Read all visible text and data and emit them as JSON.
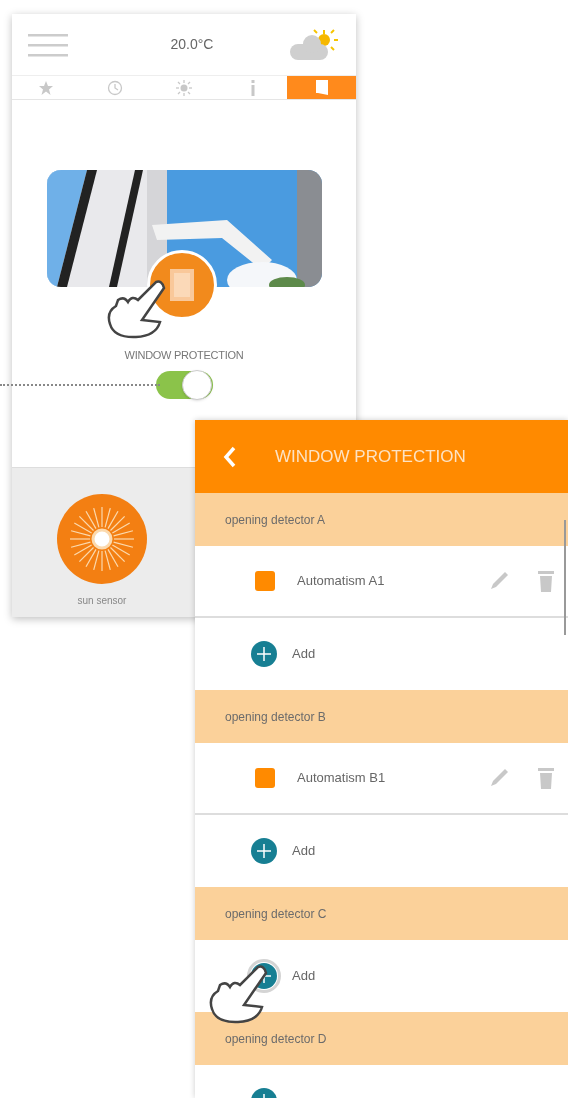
{
  "home": {
    "temperature": "20.0°C",
    "tabs": [
      {
        "kind": "star",
        "selected": false
      },
      {
        "kind": "clock",
        "selected": false
      },
      {
        "kind": "sun",
        "selected": false
      },
      {
        "kind": "info",
        "selected": false
      },
      {
        "kind": "window",
        "selected": true
      }
    ],
    "feature": {
      "label": "WINDOW PROTECTION",
      "on": true
    },
    "devices": [
      {
        "label": "sun sensor"
      }
    ]
  },
  "detail": {
    "title": "WINDOW PROTECTION",
    "groups": [
      {
        "name": "opening detector A",
        "items": [
          "Automatism A1"
        ],
        "add_label": "Add",
        "pressed": false
      },
      {
        "name": "opening detector B",
        "items": [
          "Automatism B1"
        ],
        "add_label": "Add",
        "pressed": false
      },
      {
        "name": "opening detector C",
        "add_label": "Add",
        "pressed": true
      },
      {
        "name": "opening detector D",
        "pressed": false
      }
    ]
  }
}
